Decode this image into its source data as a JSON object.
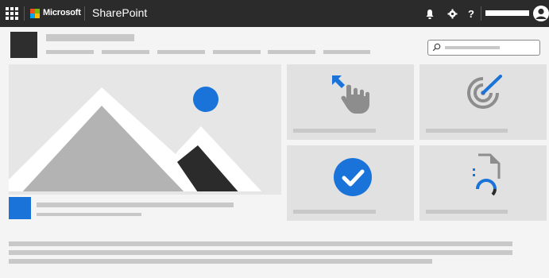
{
  "suite_bar": {
    "brand": "Microsoft",
    "app_name": "SharePoint",
    "icons": [
      "waffle-icon",
      "bell-icon",
      "gear-icon",
      "help-icon",
      "avatar-icon"
    ],
    "help_label": "?"
  },
  "colors": {
    "suite_bar_bg": "#2b2b2b",
    "accent_blue": "#1a73d9",
    "placeholder_grey": "#c8c8c8",
    "tile_bg": "#e1e1e1",
    "page_bg": "#f4f4f4"
  },
  "tiles": [
    {
      "icon": "pointer-hand-icon"
    },
    {
      "icon": "target-icon"
    },
    {
      "icon": "check-circle-icon"
    },
    {
      "icon": "document-progress-icon"
    }
  ],
  "hero": {
    "icon": "mountain-landscape-image"
  },
  "search": {
    "icon": "search-icon"
  }
}
